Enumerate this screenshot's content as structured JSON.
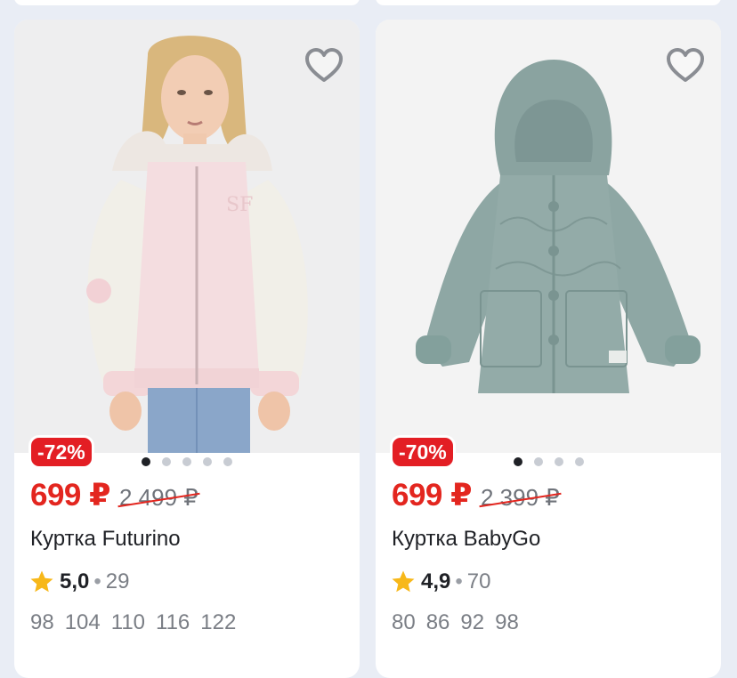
{
  "products": [
    {
      "discount": "-72%",
      "price": "699 ₽",
      "old_price": "2 499 ₽",
      "title": "Куртка Futurino",
      "rating": "5,0",
      "separator": "•",
      "reviews": "29",
      "sizes": [
        "98",
        "104",
        "110",
        "116",
        "122"
      ]
    },
    {
      "discount": "-70%",
      "price": "699 ₽",
      "old_price": "2 399 ₽",
      "title": "Куртка BabyGo",
      "rating": "4,9",
      "separator": "•",
      "reviews": "70",
      "sizes": [
        "80",
        "86",
        "92",
        "98"
      ]
    }
  ],
  "colors": {
    "discount_badge": "#e31e24",
    "price": "#e3261f",
    "star": "#f7b81a",
    "background": "#e9edf5"
  },
  "icons": [
    "heart-outline-icon",
    "star-icon"
  ]
}
